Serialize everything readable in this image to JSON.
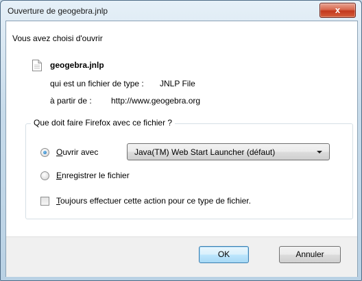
{
  "window": {
    "title": "Ouverture de geogebra.jnlp",
    "close_label": "x"
  },
  "intro": "Vous avez choisi d'ouvrir",
  "file": {
    "icon": "document-icon",
    "name": "geogebra.jnlp",
    "type_label": "qui est un fichier de type :",
    "type_value": "JNLP File",
    "from_label": "à partir de :",
    "from_value": "http://www.geogebra.org"
  },
  "group": {
    "legend": "Que doit faire Firefox avec ce fichier ?",
    "open_with": {
      "accel": "O",
      "rest": "uvrir avec",
      "selected": true
    },
    "application_select": {
      "selected": "Java(TM) Web Start Launcher (défaut)"
    },
    "save_file": {
      "accel": "E",
      "rest": "nregistrer le fichier",
      "selected": false
    },
    "always_checkbox": {
      "accel": "T",
      "rest": "oujours effectuer cette action pour ce type de fichier.",
      "checked": false
    }
  },
  "buttons": {
    "ok": "OK",
    "cancel": "Annuler"
  },
  "colors": {
    "close_button": "#c3381d",
    "title_bar": "#c7dbea",
    "radio_dot": "#1a6fb5"
  }
}
